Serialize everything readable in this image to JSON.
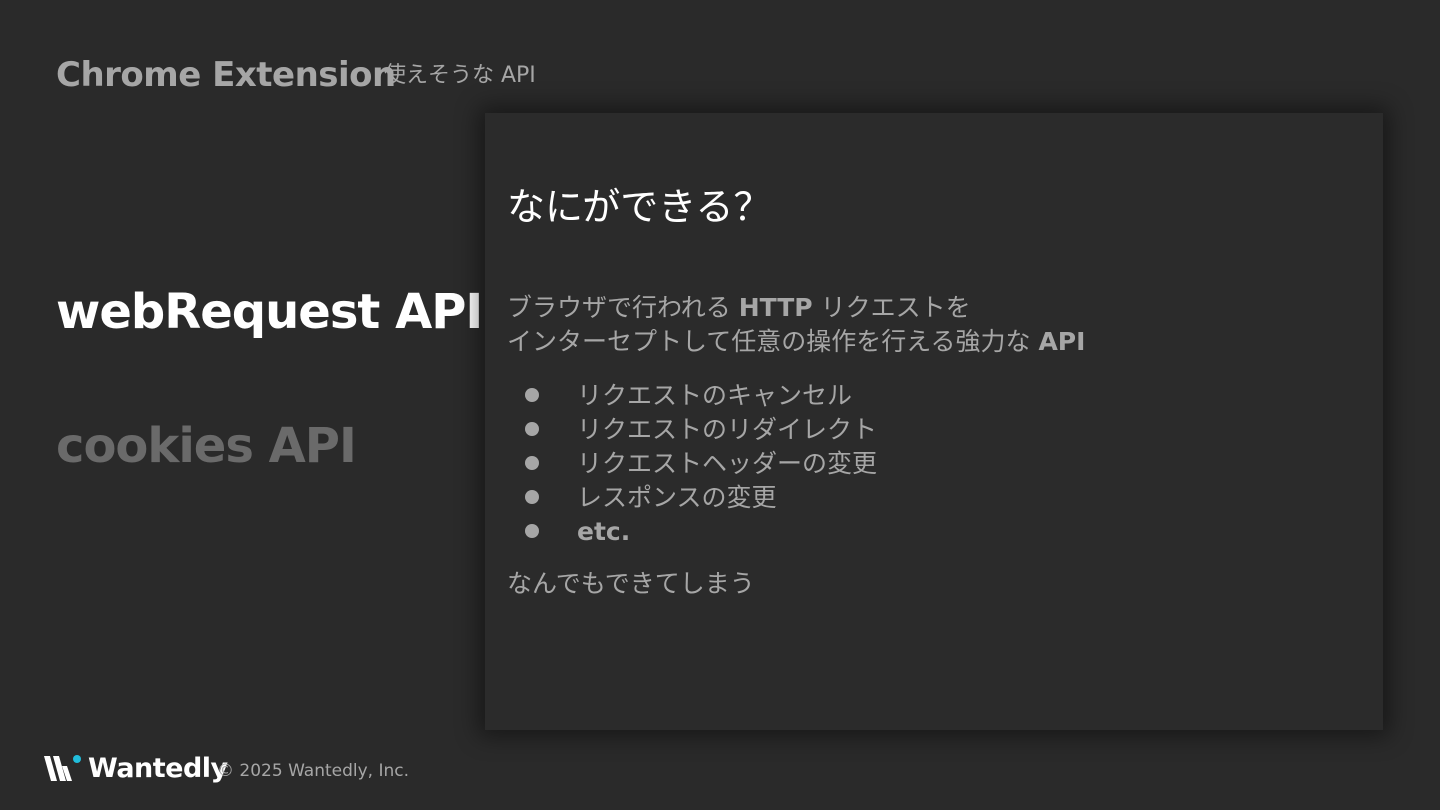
{
  "header": {
    "title": "Chrome Extension",
    "subtitle": "使えそうな API"
  },
  "sidebar": {
    "items": [
      {
        "label": "webRequest API",
        "active": true
      },
      {
        "label": "cookies API",
        "active": false
      }
    ]
  },
  "panel": {
    "title": "なにができる？",
    "intro_line1_a": "ブラウザで行われる ",
    "intro_line1_b": "HTTP",
    "intro_line1_c": " リクエストを",
    "intro_line2_a": "インターセプトして任意の操作を行える強力な ",
    "intro_line2_b": "API",
    "bullets": [
      "リクエストのキャンセル",
      "リクエストのリダイレクト",
      "リクエストヘッダーの変更",
      "レスポンスの変更",
      "etc."
    ],
    "outro": "なんでもできてしまう"
  },
  "footer": {
    "logo_text": "Wantedly",
    "copyright": "© 2025 Wantedly, Inc."
  },
  "colors": {
    "background": "#2a2a2a",
    "muted_text": "#a6a6a6",
    "inactive_text": "#6a6a6a",
    "logo_accent": "#21bddb"
  },
  "icons": {
    "logo": "wantedly-w-logo-icon",
    "bullet": "bullet-dot-icon"
  }
}
